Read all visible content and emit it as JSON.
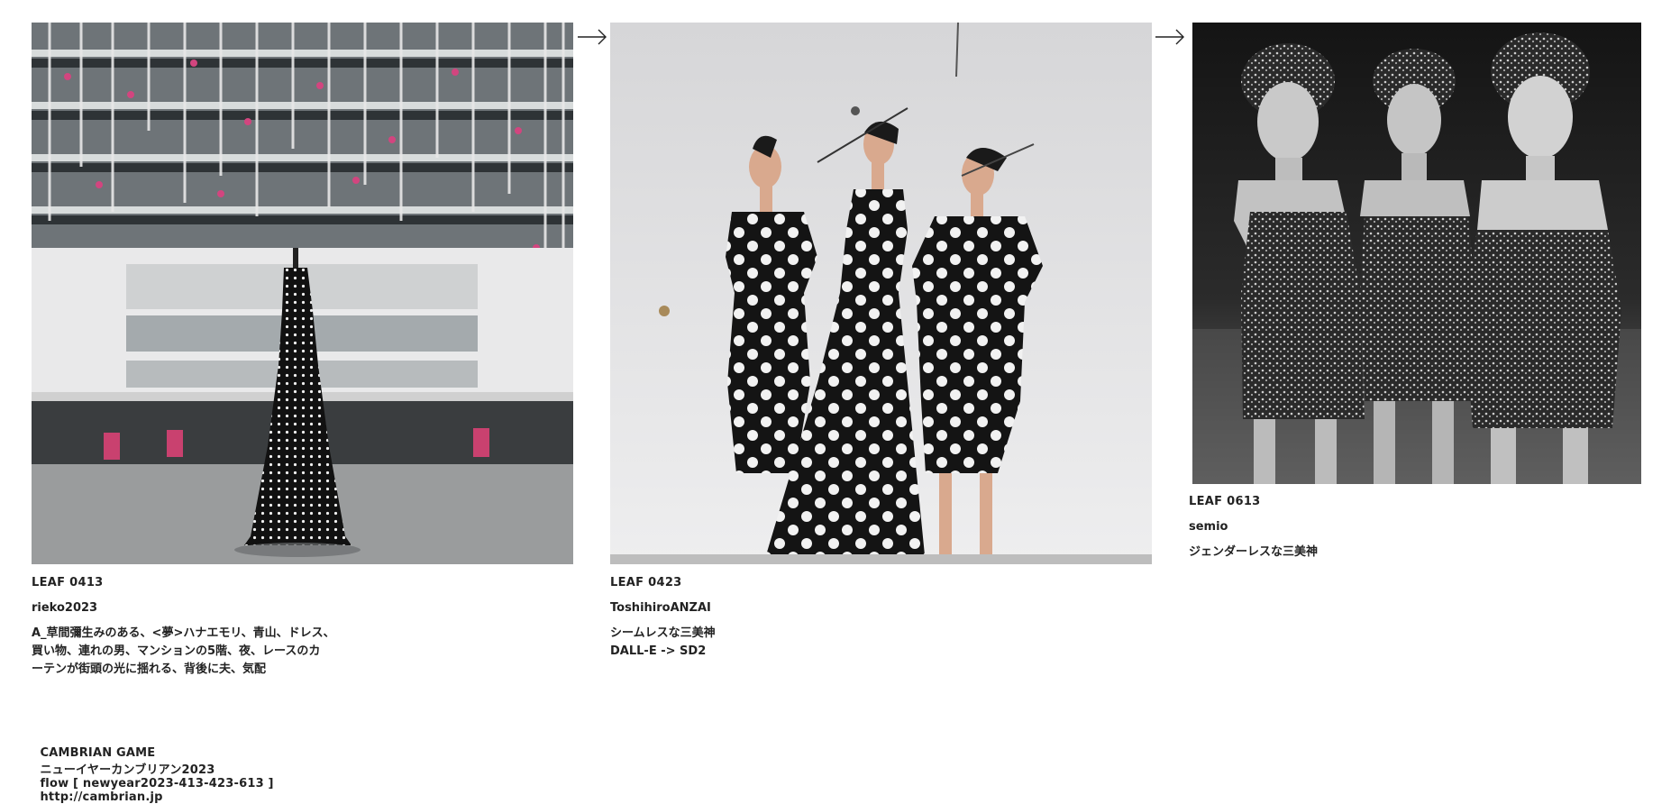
{
  "leaves": [
    {
      "id": "LEAF 0413",
      "author": "rieko2023",
      "description": "A_草間彌生みのある、<夢>ハナエモリ、青山、ドレス、\n買い物、連れの男、マンションの5階、夜、レースのカ\nーテンが街頭の光に揺れる、背後に夫、気配",
      "image_icon": "polka-dot-dress-photo"
    },
    {
      "id": "LEAF 0423",
      "author": "ToshihiroANZAI",
      "description": "シームレスな三美神\nDALL-E -> SD2",
      "image_icon": "three-figures-polka-dot-illustration"
    },
    {
      "id": "LEAF 0613",
      "author": "semio",
      "description": "ジェンダーレスな三美神",
      "image_icon": "three-women-bw-photo"
    }
  ],
  "arrows": [
    "→",
    "→"
  ],
  "footer": {
    "title": "CAMBRIAN GAME",
    "subtitle": "ニューイヤーカンブリアン2023",
    "flow": "flow [ newyear2023-413-423-613 ]",
    "url": "http://cambrian.jp"
  }
}
